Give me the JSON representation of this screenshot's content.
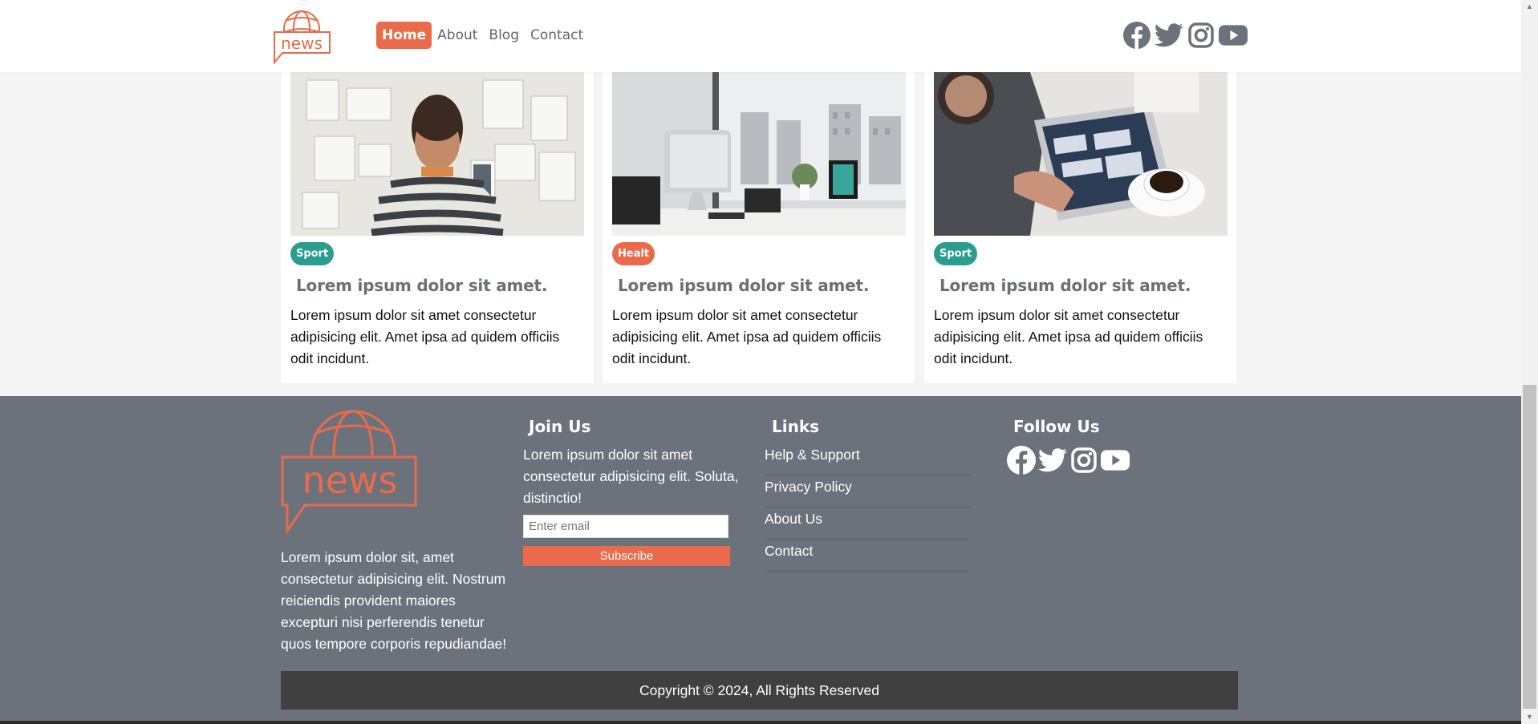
{
  "brand": {
    "logo_text": "news",
    "color": "#e96b4b"
  },
  "nav": [
    {
      "label": "Home",
      "active": true
    },
    {
      "label": "About",
      "active": false
    },
    {
      "label": "Blog",
      "active": false
    },
    {
      "label": "Contact",
      "active": false
    }
  ],
  "social_icons": [
    "facebook-icon",
    "twitter-icon",
    "instagram-icon",
    "youtube-icon"
  ],
  "cards": [
    {
      "badge": "Sport",
      "badge_color": "#2a9d8f",
      "title": "Lorem ipsum dolor sit amet.",
      "text": "Lorem ipsum dolor sit amet consectetur adipisicing elit. Amet ipsa ad quidem officiis odit incidunt."
    },
    {
      "badge": "Healt",
      "badge_color": "#e96b4b",
      "title": "Lorem ipsum dolor sit amet.",
      "text": "Lorem ipsum dolor sit amet consectetur adipisicing elit. Amet ipsa ad quidem officiis odit incidunt."
    },
    {
      "badge": "Sport",
      "badge_color": "#2a9d8f",
      "title": "Lorem ipsum dolor sit amet.",
      "text": "Lorem ipsum dolor sit amet consectetur adipisicing elit. Amet ipsa ad quidem officiis odit incidunt."
    }
  ],
  "footer": {
    "about_text": "Lorem ipsum dolor sit, amet consectetur adipisicing elit. Nostrum reiciendis provident maiores excepturi nisi perferendis tenetur quos tempore corporis repudiandae!",
    "join": {
      "heading": "Join Us",
      "text": "Lorem ipsum dolor sit amet consectetur adipisicing elit. Soluta, distinctio!",
      "email_placeholder": "Enter email",
      "subscribe_label": "Subscribe"
    },
    "links": {
      "heading": "Links",
      "items": [
        "Help & Support",
        "Privacy Policy",
        "About Us",
        "Contact"
      ]
    },
    "follow": {
      "heading": "Follow Us"
    },
    "copyright": "Copyright © 2024, All Rights Reserved"
  }
}
